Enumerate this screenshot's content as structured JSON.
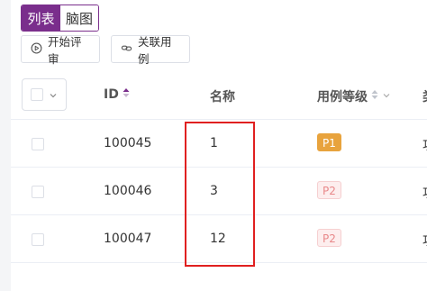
{
  "view_toggle": {
    "list_label": "列表",
    "mindmap_label": "脑图"
  },
  "toolbar": {
    "start_review_label": "开始评审",
    "link_case_label": "关联用例"
  },
  "table": {
    "headers": {
      "id": "ID",
      "name": "名称",
      "level": "用例等级",
      "more": "类"
    },
    "rows": [
      {
        "id": "100045",
        "name": "1",
        "level": "P1",
        "more": "功"
      },
      {
        "id": "100046",
        "name": "3",
        "level": "P2",
        "more": "功"
      },
      {
        "id": "100047",
        "name": "12",
        "level": "P2",
        "more": "功"
      }
    ]
  },
  "colors": {
    "accent": "#7a2e8c",
    "p1_badge": "#e8a33d",
    "p2_badge_text": "#e8888a",
    "highlight": "#e02020"
  },
  "icons": {
    "start_review": "play-circle-icon",
    "link_case": "link-icon",
    "sort_id": "sort-up-icon",
    "sort_level": "sort-icon"
  }
}
